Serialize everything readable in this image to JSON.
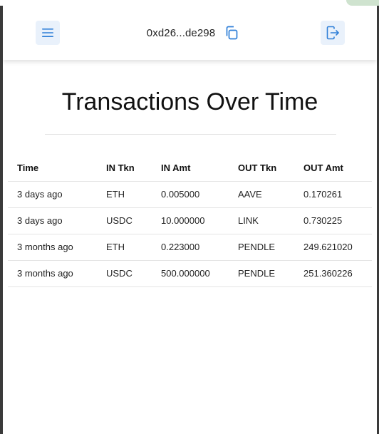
{
  "header": {
    "menu_icon": "hamburger-icon",
    "address": "0xd26...de298",
    "copy_icon": "copy-icon",
    "logout_icon": "logout-icon"
  },
  "page": {
    "title": "Transactions Over Time"
  },
  "table": {
    "columns": [
      "Time",
      "IN Tkn",
      "IN Amt",
      "OUT Tkn",
      "OUT Amt"
    ],
    "rows": [
      [
        "3 days ago",
        "ETH",
        "0.005000",
        "AAVE",
        "0.170261"
      ],
      [
        "3 days ago",
        "USDC",
        "10.000000",
        "LINK",
        "0.730225"
      ],
      [
        "3 months ago",
        "ETH",
        "0.223000",
        "PENDLE",
        "249.621020"
      ],
      [
        "3 months ago",
        "USDC",
        "500.000000",
        "PENDLE",
        "251.360226"
      ]
    ]
  },
  "colors": {
    "accent": "#2f7fd8",
    "icon_button_bg": "#e9f1fb"
  }
}
